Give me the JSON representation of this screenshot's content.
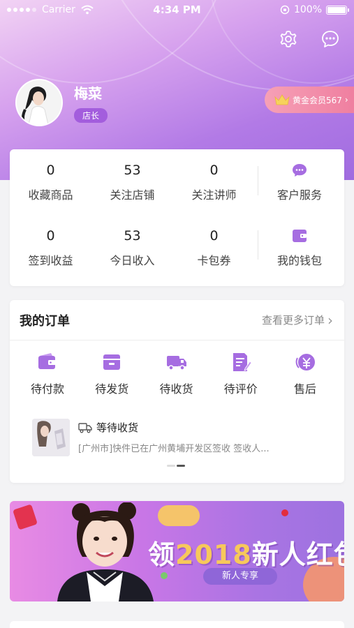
{
  "status_bar": {
    "carrier": "Carrier",
    "time": "4:34 PM",
    "battery": "100%"
  },
  "profile": {
    "name": "梅菜",
    "role": "店长"
  },
  "membership": {
    "label": "黄金会员567"
  },
  "stats": {
    "row1": [
      {
        "value": "0",
        "label": "收藏商品"
      },
      {
        "value": "53",
        "label": "关注店铺"
      },
      {
        "value": "0",
        "label": "关注讲师"
      }
    ],
    "row1_service": {
      "label": "客户服务"
    },
    "row2": [
      {
        "value": "0",
        "label": "签到收益"
      },
      {
        "value": "53",
        "label": "今日收入"
      },
      {
        "value": "0",
        "label": "卡包券"
      }
    ],
    "row2_service": {
      "label": "我的钱包"
    }
  },
  "orders": {
    "title": "我的订单",
    "more": "查看更多订单",
    "categories": [
      {
        "label": "待付款",
        "icon": "wallet-icon"
      },
      {
        "label": "待发货",
        "icon": "box-icon"
      },
      {
        "label": "待收货",
        "icon": "truck-icon"
      },
      {
        "label": "待评价",
        "icon": "review-icon"
      },
      {
        "label": "售后",
        "icon": "refund-icon"
      }
    ],
    "shipping": {
      "status": "等待收货",
      "detail": "[广州市]快件已在广州黄埔开发区签收 签收人..."
    }
  },
  "banner": {
    "prefix": "领",
    "year": "2018",
    "suffix": "新人红包",
    "sub": "新人专享"
  },
  "colors": {
    "accent": "#a66de1",
    "badge": "#a35ddd",
    "member": "#ef7fa0",
    "banner_year": "#f7c85b"
  }
}
